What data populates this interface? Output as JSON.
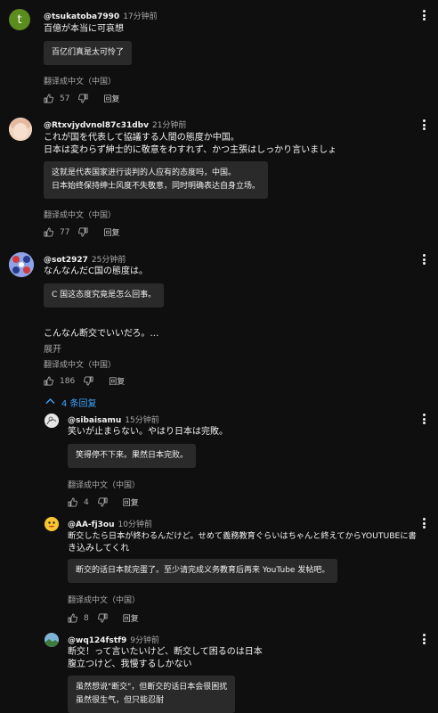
{
  "labels": {
    "translate": "翻译成中文（中国）",
    "reply": "回复",
    "expand": "展开"
  },
  "comments": [
    {
      "author": "@tsukatoba7990",
      "time": "17分钟前",
      "text": [
        "百億が本当に可哀想"
      ],
      "translation": [
        "百亿们真是太可怜了"
      ],
      "likes": "57",
      "avatar": {
        "letter": "t",
        "color": "#5b8c1e"
      }
    },
    {
      "author": "@Rtxvjydvnol87c31dbv",
      "time": "21分钟前",
      "text": [
        "これが国を代表して協議する人間の態度か中国。",
        "日本は変わらず紳士的に敬意をわすれず、かつ主張はしっかり言いましょ"
      ],
      "translation": [
        "这就是代表国家进行谈判的人应有的态度吗，中国。",
        "日本始终保持绅士风度不失敬意，同时明确表达自身立场。"
      ],
      "likes": "77"
    },
    {
      "author": "@sot2927",
      "time": "25分钟前",
      "text": [
        "なんなんだC国の態度は。"
      ],
      "translation": [
        "C 国这态度究竟是怎么回事。"
      ],
      "text_more": "こんなん断交でいいだろ。…",
      "likes": "186",
      "replies_toggle": "4 条回复"
    }
  ],
  "replies": [
    {
      "author": "@sibaisamu",
      "time": "15分钟前",
      "text": [
        "笑いが止まらない。やはり日本は完敗。"
      ],
      "translation": [
        "笑得停不下来。果然日本完败。"
      ],
      "likes": "4"
    },
    {
      "author": "@AA-fj3ou",
      "time": "10分钟前",
      "text": [
        "断交したら日本が終わるんだけど。せめて義務教育ぐらいはちゃんと終えてからYOUTUBEに書",
        "き込みしてくれ"
      ],
      "translation": [
        "断交的话日本就完蛋了。至少请完成义务教育后再来 YouTube 发帖吧。"
      ],
      "likes": "8"
    },
    {
      "author": "@wq124fstf9",
      "time": "9分钟前",
      "text": [
        "断交！って言いたいけど、断交して困るのは日本",
        "腹立つけど、我慢するしかない"
      ],
      "translation": [
        "虽然想说\"断交\"，但断交的话日本会很困扰",
        "虽然很生气，但只能忍耐"
      ]
    }
  ]
}
